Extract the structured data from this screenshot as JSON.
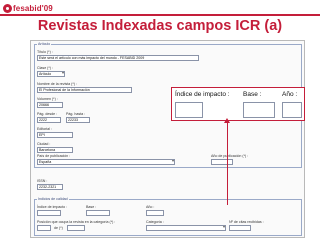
{
  "header": {
    "logo_text": "fesabid'09"
  },
  "slide": {
    "title": "Revistas Indexadas campos ICR (a)"
  },
  "form": {
    "section_article": "Artículo",
    "titulo": {
      "label": "Título (*) :",
      "value": "Este será el artículo con más impacto del mundo - FESABID 2009"
    },
    "clase": {
      "label": "Clase (*) :",
      "value": "Artículo"
    },
    "revista": {
      "label": "Nombre de la revista (*) :",
      "value": "El Profesional de la Información"
    },
    "volumen": {
      "label": "Volumen (*) :",
      "value": "20666"
    },
    "pag_desde": {
      "label": "Pág. desde :",
      "value": "2222"
    },
    "pag_hasta": {
      "label": "Pág. hasta :",
      "value": "22233"
    },
    "editorial": {
      "label": "Editorial :",
      "value": "EPI"
    },
    "ciudad": {
      "label": "Ciudad :",
      "value": "Barcelona"
    },
    "pais": {
      "label": "País de publicación :",
      "value": "España"
    },
    "anio_publicacion": {
      "label": "Año de publicación (*) :",
      "value": ""
    },
    "issn": {
      "label": "ISSN :",
      "value": "2232-2321"
    },
    "section_quality": "Indicios de calidad",
    "indice": {
      "label": "Índice de impacto :"
    },
    "base": {
      "label": "Base :"
    },
    "anio": {
      "label": "Año :"
    },
    "posicion": {
      "label": "Posición que ocupa la revista en la categoría (*) :",
      "of": "de (*)"
    },
    "categoria": {
      "label": "Categoría :"
    },
    "num_citas": {
      "label": "Nº de citas recibidas :"
    }
  },
  "callout": {
    "indice_label": "Índice de impacto :",
    "base_label": "Base :",
    "anio_label": "Año :"
  },
  "colors": {
    "accent": "#c41e3a",
    "border": "#9aa9c8"
  }
}
